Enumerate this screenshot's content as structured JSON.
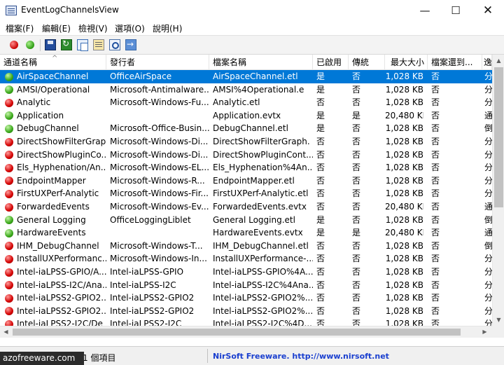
{
  "window": {
    "title": "EventLogChannelsView",
    "minimize_glyph": "—",
    "maximize_glyph": "☐",
    "close_glyph": "✕"
  },
  "menu": [
    "檔案(F)",
    "編輯(E)",
    "檢視(V)",
    "選項(O)",
    "說明(H)"
  ],
  "toolbar": [
    "enable-icon",
    "disable-icon",
    "save-icon",
    "refresh-icon",
    "copy-icon",
    "properties-icon",
    "find-icon",
    "exit-icon"
  ],
  "columns": [
    "通道名稱",
    "發行者",
    "檔案名稱",
    "已啟用",
    "傳統",
    "最大大小",
    "檔案還到...",
    "逸"
  ],
  "sort_arrow": "^",
  "rows": [
    {
      "status": "green",
      "name": "AirSpaceChannel",
      "publisher": "OfficeAirSpace",
      "file": "AirSpaceChannel.etl",
      "enabled": "是",
      "classic": "否",
      "size": "1,028 KB",
      "retention": "否",
      "extra": "分"
    },
    {
      "status": "green",
      "name": "AMSI/Operational",
      "publisher": "Microsoft-Antimalware...",
      "file": "AMSI%4Operational.e",
      "enabled": "是",
      "classic": "否",
      "size": "1,028 KB",
      "retention": "否",
      "extra": "分"
    },
    {
      "status": "red",
      "name": "Analytic",
      "publisher": "Microsoft-Windows-Fu...",
      "file": "Analytic.etl",
      "enabled": "否",
      "classic": "否",
      "size": "1,028 KB",
      "retention": "否",
      "extra": "分"
    },
    {
      "status": "green",
      "name": "Application",
      "publisher": "",
      "file": "Application.evtx",
      "enabled": "是",
      "classic": "是",
      "size": "20,480 KB",
      "retention": "否",
      "extra": "通"
    },
    {
      "status": "green",
      "name": "DebugChannel",
      "publisher": "Microsoft-Office-Busin...",
      "file": "DebugChannel.etl",
      "enabled": "是",
      "classic": "否",
      "size": "1,028 KB",
      "retention": "否",
      "extra": "倒"
    },
    {
      "status": "red",
      "name": "DirectShowFilterGraph",
      "publisher": "Microsoft-Windows-Di...",
      "file": "DirectShowFilterGraph.",
      "enabled": "否",
      "classic": "否",
      "size": "1,028 KB",
      "retention": "否",
      "extra": "分"
    },
    {
      "status": "red",
      "name": "DirectShowPluginCo...",
      "publisher": "Microsoft-Windows-Di...",
      "file": "DirectShowPluginCont...",
      "enabled": "否",
      "classic": "否",
      "size": "1,028 KB",
      "retention": "否",
      "extra": "分"
    },
    {
      "status": "red",
      "name": "Els_Hyphenation/An...",
      "publisher": "Microsoft-Windows-EL...",
      "file": "Els_Hyphenation%4An...",
      "enabled": "否",
      "classic": "否",
      "size": "1,028 KB",
      "retention": "否",
      "extra": "分"
    },
    {
      "status": "red",
      "name": "EndpointMapper",
      "publisher": "Microsoft-Windows-R...",
      "file": "EndpointMapper.etl",
      "enabled": "否",
      "classic": "否",
      "size": "1,028 KB",
      "retention": "否",
      "extra": "分"
    },
    {
      "status": "red",
      "name": "FirstUXPerf-Analytic",
      "publisher": "Microsoft-Windows-Fir...",
      "file": "FirstUXPerf-Analytic.etl",
      "enabled": "否",
      "classic": "否",
      "size": "1,028 KB",
      "retention": "否",
      "extra": "分"
    },
    {
      "status": "red",
      "name": "ForwardedEvents",
      "publisher": "Microsoft-Windows-Ev...",
      "file": "ForwardedEvents.evtx",
      "enabled": "否",
      "classic": "否",
      "size": "20,480 KB",
      "retention": "否",
      "extra": "通"
    },
    {
      "status": "green",
      "name": "General Logging",
      "publisher": "OfficeLoggingLiblet",
      "file": "General Logging.etl",
      "enabled": "是",
      "classic": "否",
      "size": "1,028 KB",
      "retention": "否",
      "extra": "倒"
    },
    {
      "status": "green",
      "name": "HardwareEvents",
      "publisher": "",
      "file": "HardwareEvents.evtx",
      "enabled": "是",
      "classic": "是",
      "size": "20,480 KB",
      "retention": "否",
      "extra": "通"
    },
    {
      "status": "red",
      "name": "IHM_DebugChannel",
      "publisher": "Microsoft-Windows-T...",
      "file": "IHM_DebugChannel.etl",
      "enabled": "否",
      "classic": "否",
      "size": "1,028 KB",
      "retention": "否",
      "extra": "倒"
    },
    {
      "status": "red",
      "name": "InstallUXPerformanc...",
      "publisher": "Microsoft-Windows-In...",
      "file": "InstallUXPerformance-...",
      "enabled": "否",
      "classic": "否",
      "size": "1,028 KB",
      "retention": "否",
      "extra": "分"
    },
    {
      "status": "red",
      "name": "Intel-iaLPSS-GPIO/A...",
      "publisher": "Intel-iaLPSS-GPIO",
      "file": "Intel-iaLPSS-GPIO%4A...",
      "enabled": "否",
      "classic": "否",
      "size": "1,028 KB",
      "retention": "否",
      "extra": "分"
    },
    {
      "status": "red",
      "name": "Intel-iaLPSS-I2C/Ana...",
      "publisher": "Intel-iaLPSS-I2C",
      "file": "Intel-iaLPSS-I2C%4Ana...",
      "enabled": "否",
      "classic": "否",
      "size": "1,028 KB",
      "retention": "否",
      "extra": "分"
    },
    {
      "status": "red",
      "name": "Intel-iaLPSS2-GPIO2...",
      "publisher": "Intel-iaLPSS2-GPIO2",
      "file": "Intel-iaLPSS2-GPIO2%...",
      "enabled": "否",
      "classic": "否",
      "size": "1,028 KB",
      "retention": "否",
      "extra": "分"
    },
    {
      "status": "red",
      "name": "Intel-iaLPSS2-GPIO2...",
      "publisher": "Intel-iaLPSS2-GPIO2",
      "file": "Intel-iaLPSS2-GPIO2%...",
      "enabled": "否",
      "classic": "否",
      "size": "1,028 KB",
      "retention": "否",
      "extra": "分"
    },
    {
      "status": "red",
      "name": "Intel-iaLPSS2-I2C/De",
      "publisher": "Intel-iaLPSS2-I2C",
      "file": "Intel-iaLPSS2-I2C%4D...",
      "enabled": "否",
      "classic": "否",
      "size": "1,028 KB",
      "retention": "否",
      "extra": "分"
    }
  ],
  "selected_row": 0,
  "status": {
    "count": "1 個項目",
    "nirsoft": "NirSoft Freeware.  http://www.nirsoft.net"
  },
  "watermark": "azofreeware.com",
  "colors": {
    "selection": "#0078d7",
    "link": "#1a3fcf"
  }
}
